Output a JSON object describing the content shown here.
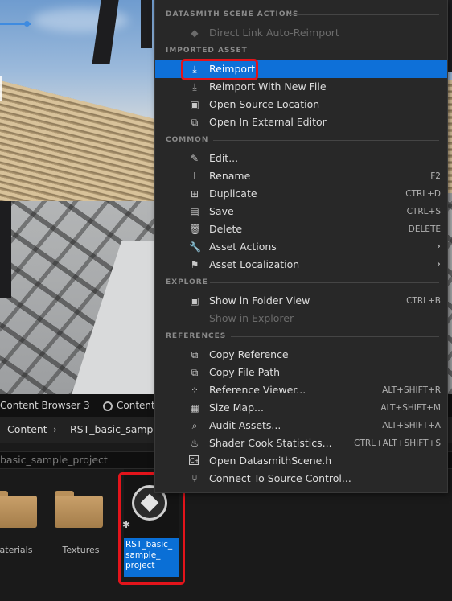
{
  "context_menu": {
    "sections": {
      "datasmith": "DATASMITH SCENE ACTIONS",
      "imported": "IMPORTED ASSET",
      "common": "COMMON",
      "explore": "EXPLORE",
      "references": "REFERENCES"
    },
    "items": {
      "direct_link": {
        "label": "Direct Link Auto-Reimport",
        "icon": "diamond-icon",
        "disabled": true
      },
      "reimport": {
        "label": "Reimport",
        "icon": "reimport-icon",
        "selected": true
      },
      "reimport_new": {
        "label": "Reimport With New File",
        "icon": "reimport-file-icon"
      },
      "open_source": {
        "label": "Open Source Location",
        "icon": "folder-open-icon"
      },
      "open_external": {
        "label": "Open In External Editor",
        "icon": "external-editor-icon"
      },
      "edit": {
        "label": "Edit...",
        "icon": "pencil-icon"
      },
      "rename": {
        "label": "Rename",
        "icon": "rename-icon",
        "shortcut": "F2"
      },
      "duplicate": {
        "label": "Duplicate",
        "icon": "duplicate-icon",
        "shortcut": "CTRL+D"
      },
      "save": {
        "label": "Save",
        "icon": "save-icon",
        "shortcut": "CTRL+S"
      },
      "delete": {
        "label": "Delete",
        "icon": "trash-icon",
        "shortcut": "DELETE"
      },
      "asset_actions": {
        "label": "Asset Actions",
        "icon": "wrench-icon",
        "submenu": true
      },
      "asset_localization": {
        "label": "Asset Localization",
        "icon": "flag-icon",
        "submenu": true
      },
      "show_folder": {
        "label": "Show in Folder View",
        "icon": "folder-search-icon",
        "shortcut": "CTRL+B"
      },
      "show_explorer": {
        "label": "Show in Explorer",
        "icon": "explorer-icon",
        "disabled": true
      },
      "copy_ref": {
        "label": "Copy Reference",
        "icon": "copy-icon"
      },
      "copy_path": {
        "label": "Copy File Path",
        "icon": "copy-path-icon"
      },
      "ref_viewer": {
        "label": "Reference Viewer...",
        "icon": "graph-icon",
        "shortcut": "ALT+SHIFT+R"
      },
      "size_map": {
        "label": "Size Map...",
        "icon": "size-map-icon",
        "shortcut": "ALT+SHIFT+M"
      },
      "audit": {
        "label": "Audit Assets...",
        "icon": "audit-icon",
        "shortcut": "ALT+SHIFT+A"
      },
      "shader_cook": {
        "label": "Shader Cook Statistics...",
        "icon": "cook-icon",
        "shortcut": "CTRL+ALT+SHIFT+S"
      },
      "open_datasmith": {
        "label": "Open DatasmithScene.h",
        "icon": "code-file-icon"
      },
      "connect_source": {
        "label": "Connect To Source Control...",
        "icon": "source-control-icon"
      }
    }
  },
  "content_browser": {
    "tabs": [
      "Content Browser 3",
      "Content"
    ],
    "breadcrumb": [
      "Content",
      "RST_basic_sample"
    ],
    "search_value": "basic_sample_project",
    "folders": [
      "aterials",
      "Textures"
    ],
    "asset": {
      "name_lines": [
        "RST_basic_",
        "sample_",
        "project"
      ],
      "icon": "datasmith-scene-icon"
    }
  },
  "colors": {
    "highlight": "#e3141b",
    "selected": "#0e70d8",
    "menu_bg": "#282828"
  }
}
